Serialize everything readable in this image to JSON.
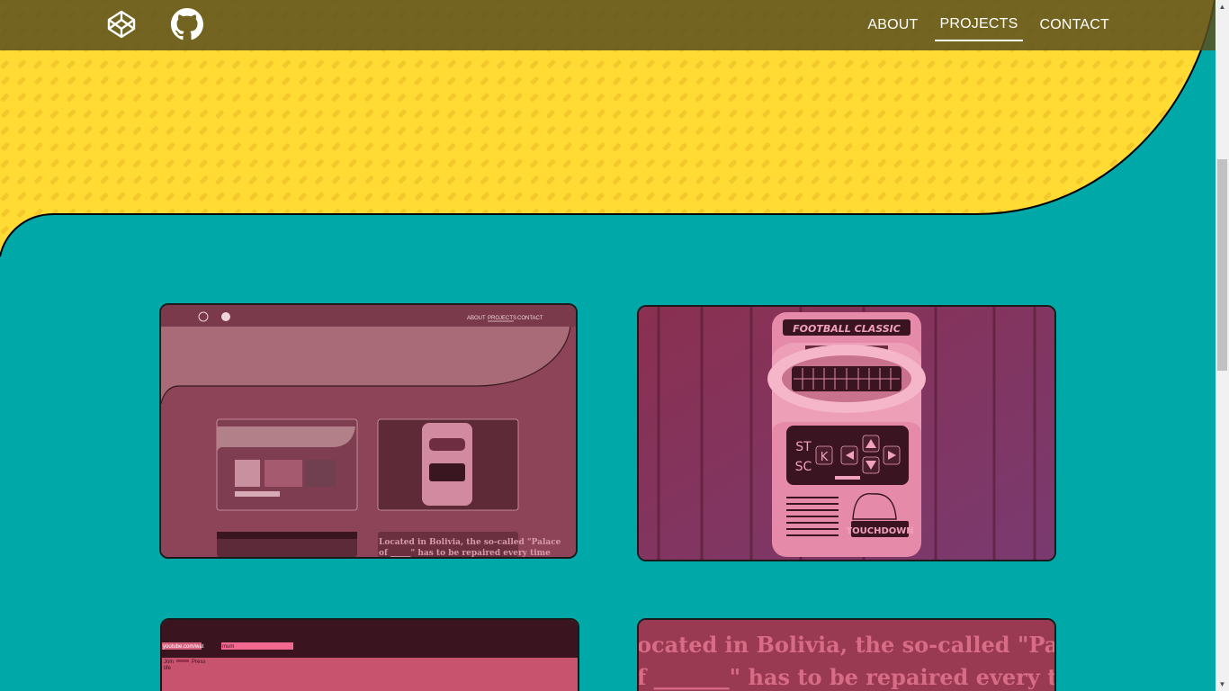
{
  "nav": {
    "links": [
      {
        "label": "ABOUT",
        "active": false
      },
      {
        "label": "PROJECTS",
        "active": true
      },
      {
        "label": "CONTACT",
        "active": false
      }
    ],
    "icons": [
      "codepen-icon",
      "github-icon"
    ]
  },
  "cards": {
    "portfolio": {
      "mini_nav": [
        "ABOUT",
        "PROJECTS",
        "CONTACT"
      ],
      "snippet": "Located in Bolivia, the so-called \"Palace",
      "snippet2": "of _____\" has to be repaired every time"
    },
    "handheld": {
      "title": "FOOTBALL CLASSIC",
      "btn_st": "ST",
      "btn_sc": "SC",
      "btn_k": "K",
      "brand": "TOUCHDOWN"
    },
    "search": {
      "url_text": "youtube.com/wat",
      "query_text": "mum",
      "line1": "Join",
      "line1b": "Press",
      "line2": "tife"
    },
    "quote": {
      "line1": "ocated in Bolivia, the so-called \"Palac",
      "line2": "f _______\" has to be repaired every tim"
    }
  },
  "colors": {
    "background": "#00a8a8",
    "hero_yellow": "#ffd933",
    "navbar": "#5a501e",
    "card_tint": "#c4446a"
  }
}
